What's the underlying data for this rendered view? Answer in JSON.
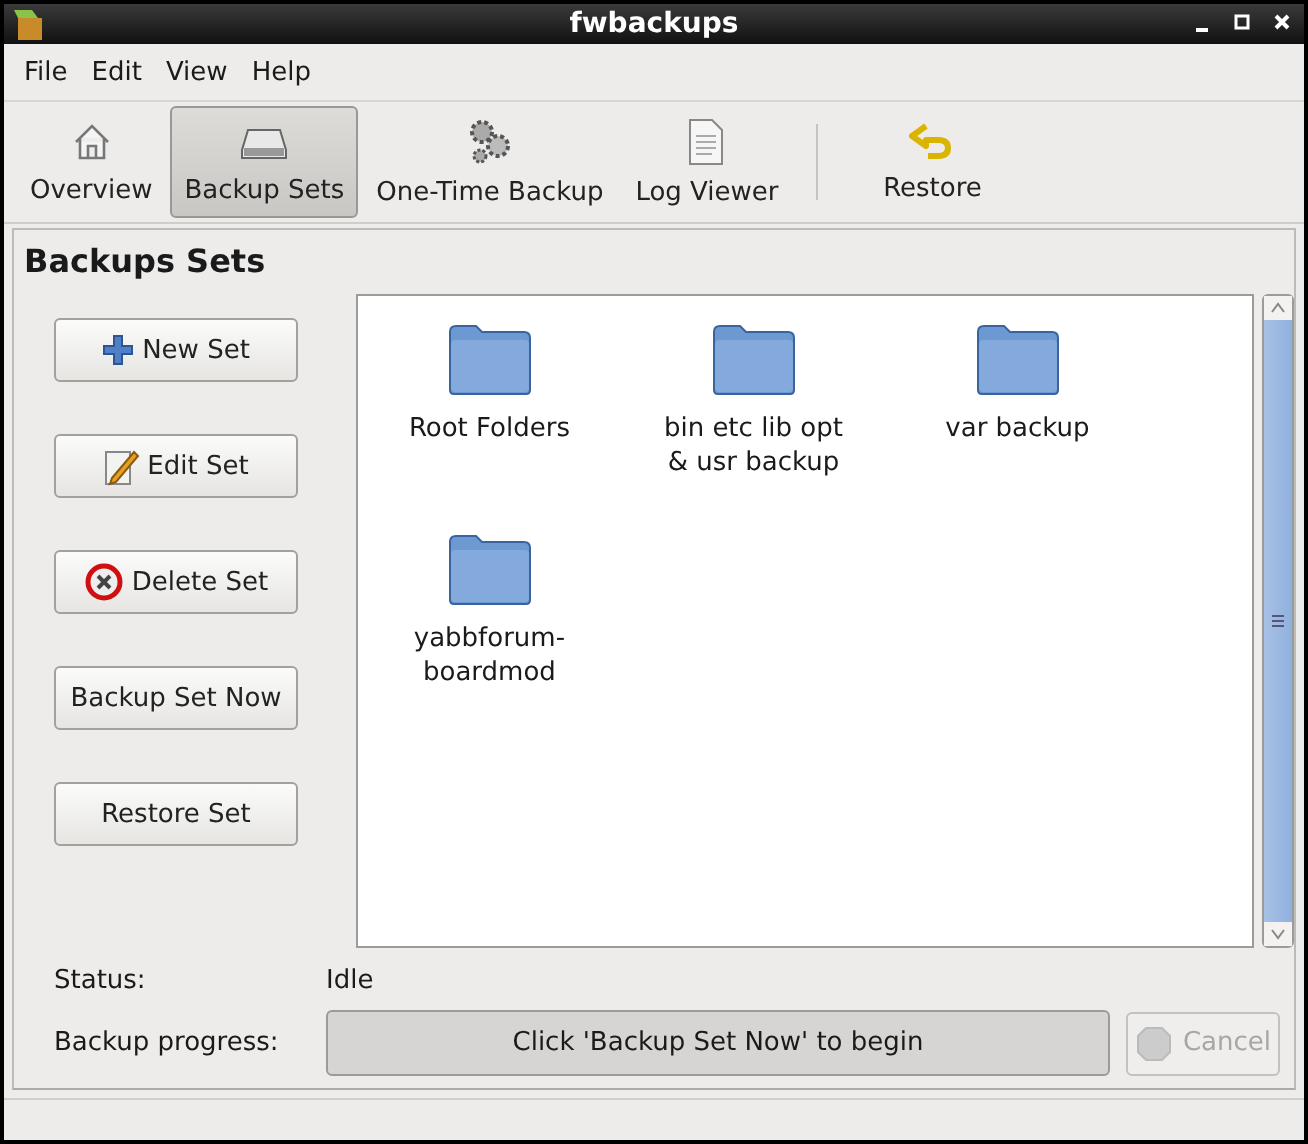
{
  "window": {
    "title": "fwbackups"
  },
  "menu": [
    "File",
    "Edit",
    "View",
    "Help"
  ],
  "toolbar": {
    "views": [
      {
        "label": "Overview",
        "selected": false
      },
      {
        "label": "Backup Sets",
        "selected": true
      },
      {
        "label": "One-Time Backup",
        "selected": false
      },
      {
        "label": "Log Viewer",
        "selected": false
      }
    ],
    "actions": [
      {
        "label": "Restore"
      }
    ]
  },
  "heading": "Backups Sets",
  "buttons": [
    "New Set",
    "Edit Set",
    "Delete Set",
    "Backup Set Now",
    "Restore Set"
  ],
  "sets": [
    {
      "name": "Root Folders"
    },
    {
      "name": "bin etc lib opt & usr backup"
    },
    {
      "name": "var backup"
    },
    {
      "name": "yabbforum-boardmod"
    }
  ],
  "status": {
    "label": "Status:",
    "value": "Idle"
  },
  "progress": {
    "label": "Backup progress:",
    "text": "Click 'Backup Set Now' to begin",
    "level": 0
  },
  "cancel": {
    "label": "Cancel",
    "disabled": true
  }
}
